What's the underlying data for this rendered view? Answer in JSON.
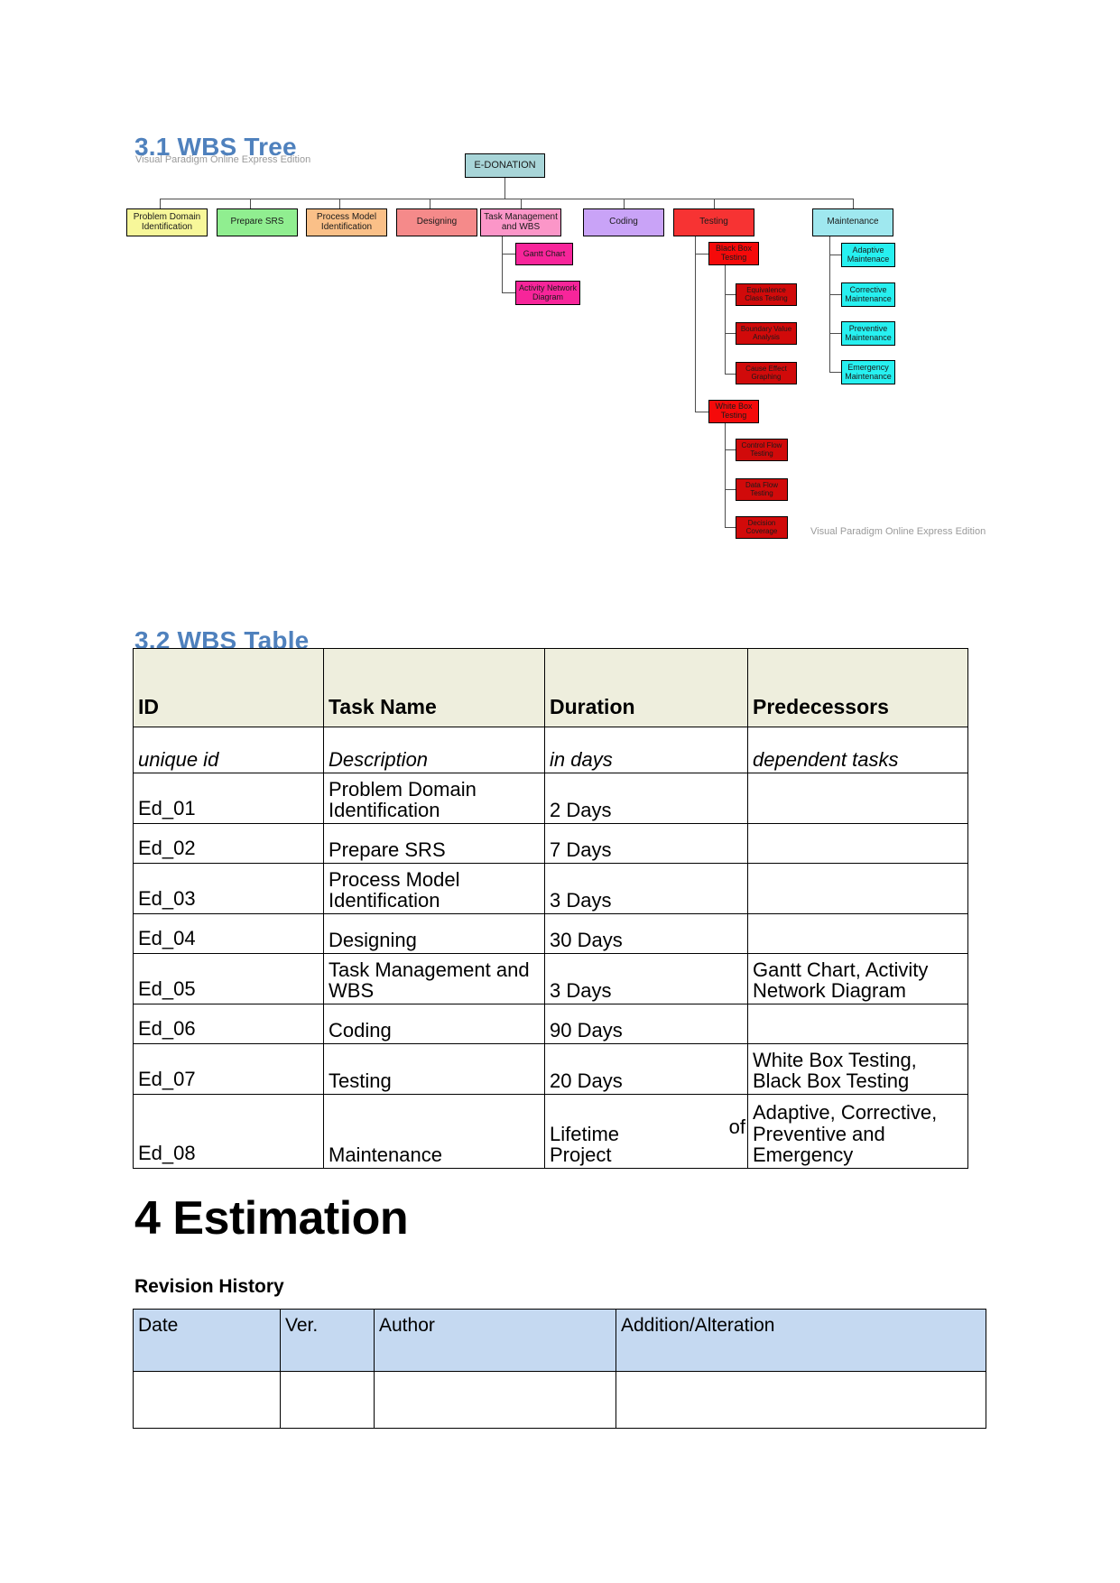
{
  "sections": {
    "wbs_tree_heading": "3.1 WBS Tree",
    "wbs_table_heading": "3.2 WBS Table",
    "estimation_heading": "4 Estimation",
    "revision_history_heading": "Revision History"
  },
  "watermark": {
    "top": "Visual Paradigm Online Express Edition",
    "bottom": "Visual Paradigm Online Express Edition"
  },
  "tree": {
    "root": "E-DONATION",
    "level1": [
      {
        "label": "Problem Domain Identification",
        "color": "#f7f79a"
      },
      {
        "label": "Prepare SRS",
        "color": "#90ee90"
      },
      {
        "label": "Process Model Identification",
        "color": "#fac088"
      },
      {
        "label": "Designing",
        "color": "#f58a8a"
      },
      {
        "label": "Task Management and WBS",
        "color": "#fb96c8"
      },
      {
        "label": "Coding",
        "color": "#c9a3f7"
      },
      {
        "label": "Testing",
        "color": "#f73333"
      },
      {
        "label": "Maintenance",
        "color": "#9fe8ef"
      }
    ],
    "task_children": [
      {
        "label": "Gantt Chart",
        "color": "#f7259a"
      },
      {
        "label": "Activity Network Diagram",
        "color": "#f7259a"
      }
    ],
    "testing_children": [
      {
        "label": "Black Box Testing",
        "color": "#f50a0a"
      },
      {
        "label": "White Box Testing",
        "color": "#f50a0a"
      }
    ],
    "black_box_children": [
      {
        "label": "Equivalence Class Testing",
        "color": "#d10a0a"
      },
      {
        "label": "Boundary Value Analysis",
        "color": "#d10a0a"
      },
      {
        "label": "Cause Effect Graphing",
        "color": "#d10a0a"
      }
    ],
    "white_box_children": [
      {
        "label": "Control Flow Testing",
        "color": "#d10a0a"
      },
      {
        "label": "Data Flow Testing",
        "color": "#d10a0a"
      },
      {
        "label": "Decision Coverage",
        "color": "#d10a0a"
      }
    ],
    "maintenance_children": [
      {
        "label": "Adaptive Maintenace",
        "color": "#27f0f0"
      },
      {
        "label": "Corrective Maintenance",
        "color": "#27f0f0"
      },
      {
        "label": "Preventive Maintenance",
        "color": "#27f0f0"
      },
      {
        "label": "Emergency Maintenance",
        "color": "#27f0f0"
      }
    ],
    "root_color": "#a8d5d8"
  },
  "wbs_table": {
    "headers": [
      "ID",
      "Task Name",
      "Duration",
      "Predecessors"
    ],
    "subheader": [
      "unique id",
      "Description",
      "in days",
      "dependent tasks"
    ],
    "rows": [
      {
        "id": "Ed_01",
        "task": "Problem Domain Identification",
        "duration": "2 Days",
        "predecessors": ""
      },
      {
        "id": "Ed_02",
        "task": "Prepare SRS",
        "duration": "7 Days",
        "predecessors": ""
      },
      {
        "id": "Ed_03",
        "task": "Process Model Identification",
        "duration": "3 Days",
        "predecessors": ""
      },
      {
        "id": "Ed_04",
        "task": "Designing",
        "duration": "30 Days",
        "predecessors": ""
      },
      {
        "id": "Ed_05",
        "task": "Task Management and WBS",
        "duration": "3 Days",
        "predecessors": "Gantt Chart, Activity Network Diagram"
      },
      {
        "id": "Ed_06",
        "task": "Coding",
        "duration": "90 Days",
        "predecessors": ""
      },
      {
        "id": "Ed_07",
        "task": "Testing",
        "duration": "20 Days",
        "predecessors": "White Box Testing, Black Box Testing"
      },
      {
        "id": "Ed_08",
        "task": "Maintenance",
        "duration_line1": "Lifetime",
        "duration_of": "of",
        "duration_line2": "Project",
        "predecessors": "Adaptive, Corrective, Preventive and Emergency"
      }
    ]
  },
  "revision_table": {
    "headers": [
      "Date",
      "Ver.",
      "Author",
      "Addition/Alteration"
    ],
    "rows": [
      {
        "date": "",
        "ver": "",
        "author": "",
        "change": ""
      }
    ]
  },
  "colors": {
    "heading_blue": "#4f81bd",
    "wbs_header_bg": "#eeeedd",
    "rev_header_bg": "#c5d9f1"
  }
}
